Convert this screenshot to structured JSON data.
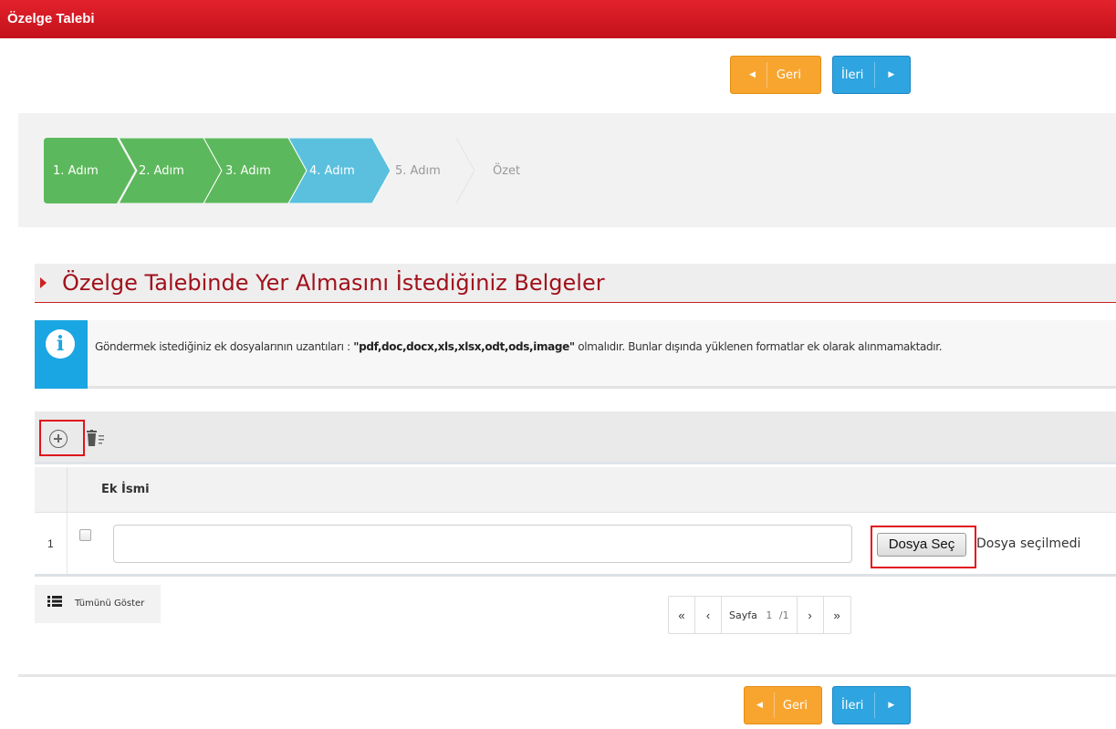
{
  "window": {
    "title": "Özelge Talebi"
  },
  "nav": {
    "back_label": "Geri",
    "next_label": "İleri"
  },
  "steps": [
    {
      "label": "1. Adım",
      "state": "done"
    },
    {
      "label": "2. Adım",
      "state": "done"
    },
    {
      "label": "3. Adım",
      "state": "done"
    },
    {
      "label": "4. Adım",
      "state": "active"
    },
    {
      "label": "5. Adım",
      "state": "pending"
    },
    {
      "label": "Özet",
      "state": "pending"
    }
  ],
  "section": {
    "title": "Özelge Talebinde Yer Almasını İstediğiniz Belgeler"
  },
  "info": {
    "text_before": "Göndermek istediğiniz ek dosyalarının uzantıları : ",
    "extensions": "\"pdf,doc,docx,xls,xlsx,odt,ods,image\"",
    "text_after": " olmalıdır. Bunlar dışında yüklenen formatlar ek olarak alınmamaktadır."
  },
  "toolbar": {
    "add_icon": "plus-circle-icon",
    "delete_icon": "trash-list-icon"
  },
  "table": {
    "columns": [
      "Ek İsmi"
    ],
    "rows": [
      {
        "num": "1",
        "checked": false,
        "name_value": "",
        "file_button": "Dosya Seç",
        "file_status": "Dosya seçilmedi"
      }
    ]
  },
  "footer": {
    "show_all_label": "Tümünü Göster",
    "show_all_icon": "list-icon"
  },
  "pager": {
    "first": "«",
    "prev": "‹",
    "page_label": "Sayfa",
    "current": "1",
    "total": "/1",
    "next": "›",
    "last": "»"
  },
  "colors": {
    "brand_red": "#d11720",
    "step_done": "#5cb85c",
    "step_active": "#5bc0de",
    "back_button": "#f8a530",
    "next_button": "#2ea5e0",
    "info_blue": "#1aa6e2"
  }
}
